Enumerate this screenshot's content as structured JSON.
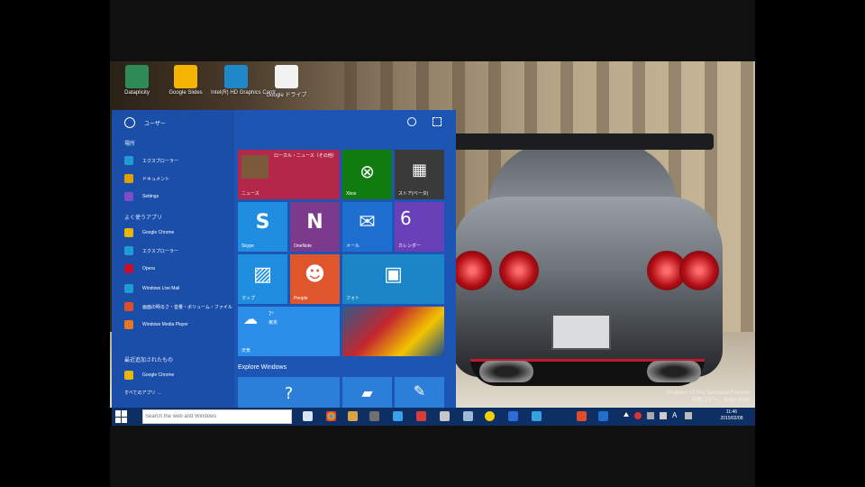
{
  "desktop_icons": [
    {
      "label": "Dataplicity",
      "color": "#2e8b57"
    },
    {
      "label": "Google Slides",
      "color": "#f4b400"
    },
    {
      "label": "Intel(R) HD Graphics Contr",
      "color": "#1e88c8"
    },
    {
      "label": "Google ドライブ",
      "color": "#f2f2f2"
    }
  ],
  "watermark": {
    "line1": "Windows 10 Pro Technical Preview",
    "line2": "評価コピー。Build 9926"
  },
  "start_menu": {
    "user_name": "ユーザー",
    "places_heading": "場所",
    "places": [
      {
        "label": "エクスプローラー",
        "color": "#1f9bd6"
      },
      {
        "label": "ドキュメント",
        "color": "#e0a100"
      },
      {
        "label": "Settings",
        "color": "#7b4fc8"
      }
    ],
    "most_used_heading": "よく使うアプリ",
    "most_used": [
      {
        "label": "Google Chrome",
        "color": "#e8b800"
      },
      {
        "label": "エクスプローラー",
        "color": "#1f9bd6"
      },
      {
        "label": "Opera",
        "color": "#c8102e"
      },
      {
        "label": "Windows Live Mail",
        "color": "#1f9bd6"
      },
      {
        "label": "画面の明るさ・音量・ボリューム・ファイル",
        "color": "#d9502b"
      },
      {
        "label": "Windows Media Player",
        "color": "#e87722"
      }
    ],
    "recent_heading": "最近追加されたもの",
    "recent": [
      {
        "label": "Google Chrome",
        "color": "#e8b800"
      }
    ],
    "all_apps": "すべてのアプリ →",
    "explore_heading": "Explore Windows",
    "tiles": {
      "news_label": "ニュース",
      "news_headline": "ローカル・ニュース（その他）",
      "xbox_label": "Xbox",
      "store_label": "ストア(ベータ)",
      "skype_label": "Skype",
      "onenote_label": "OneNote",
      "mail_label": "メール",
      "calendar_label": "カレンダー",
      "calendar_day": "6",
      "maps_label": "マップ",
      "people_label": "People",
      "photos_label": "フォト",
      "weather_label": "天気",
      "weather_temp": "7°",
      "weather_place": "東京",
      "sports_label": ""
    }
  },
  "taskbar": {
    "search_placeholder": "Search the web and Windows",
    "clock_time": "11:46",
    "clock_date": "2015/02/08",
    "ime": "A",
    "icons": [
      "task-view",
      "chrome",
      "explorer",
      "store",
      "ie",
      "mail",
      "skype",
      "onenote",
      "chrome-2",
      "ag",
      "maps"
    ]
  }
}
